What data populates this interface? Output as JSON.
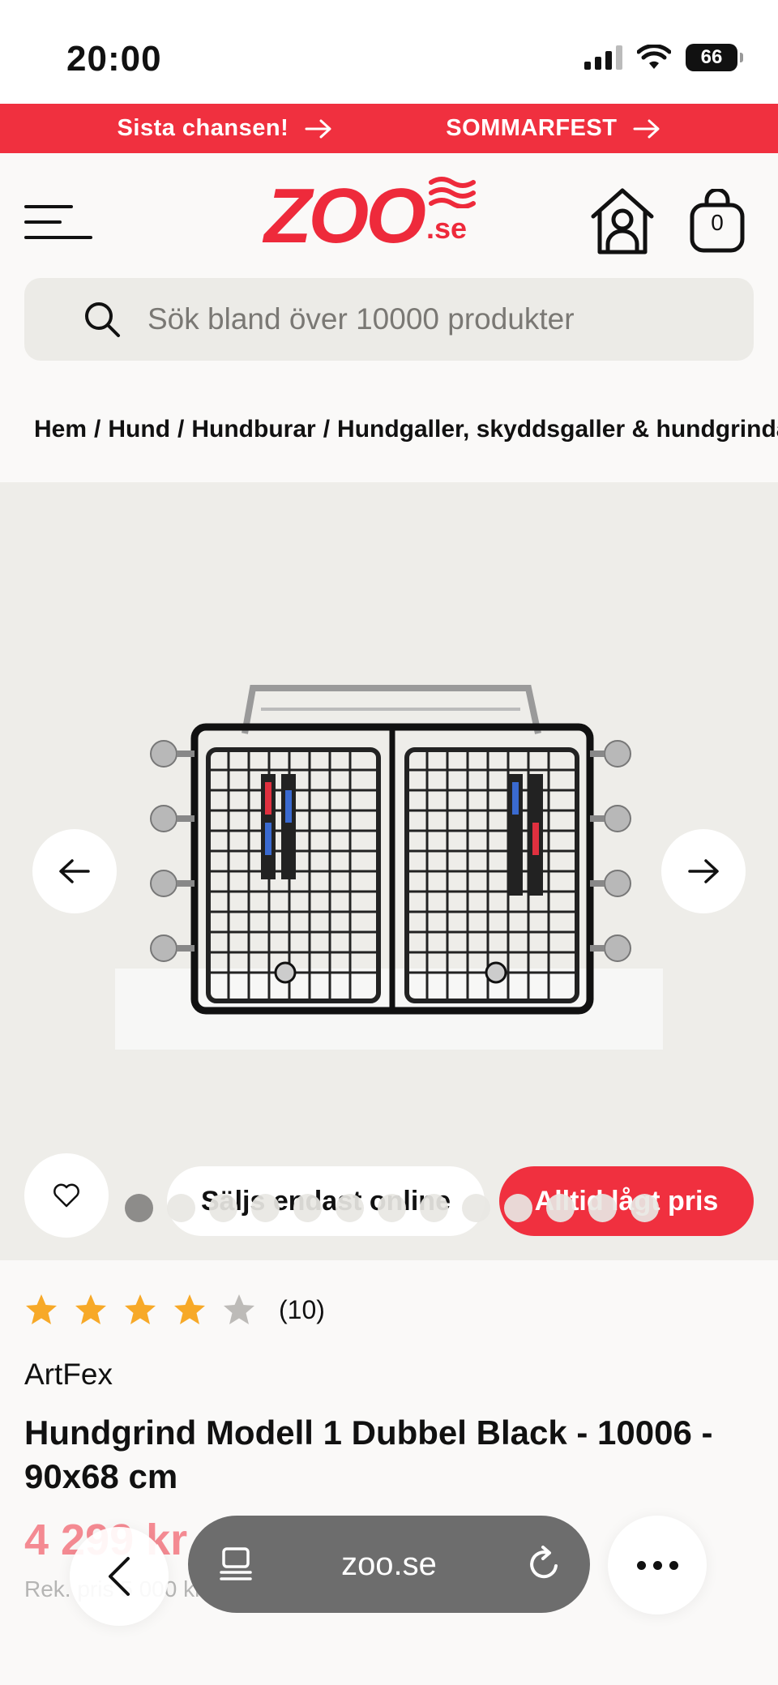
{
  "status_bar": {
    "time": "20:00",
    "battery": "66"
  },
  "promo": {
    "items": [
      {
        "label": "Sista chansen!"
      },
      {
        "label": "SOMMARFEST"
      }
    ]
  },
  "header": {
    "logo_text": "ZOO",
    "logo_suffix": ".se",
    "cart_count": "0"
  },
  "search": {
    "placeholder": "Sök bland över 10000 produkter"
  },
  "breadcrumb": {
    "items": [
      "Hem",
      "Hund",
      "Hundburar",
      "Hundgaller, skyddsgaller & hundgrindar"
    ],
    "separator": "/"
  },
  "gallery": {
    "badges": {
      "online": "Säljs endast online",
      "price": "Alltid lågt pris"
    },
    "image_count": 13,
    "active_index": 0
  },
  "product": {
    "rating": 4,
    "rating_max": 5,
    "review_count": "(10)",
    "brand": "ArtFex",
    "title": "Hundgrind Modell 1 Dubbel Black - 10006 - 90x68 cm",
    "price": "4 299 kr",
    "recommended_price": "Rek. pris 5 000 kr"
  },
  "browser": {
    "url": "zoo.se"
  },
  "colors": {
    "brand_red": "#f0303f",
    "star": "#f7a928",
    "star_empty": "#bdbbb8"
  }
}
